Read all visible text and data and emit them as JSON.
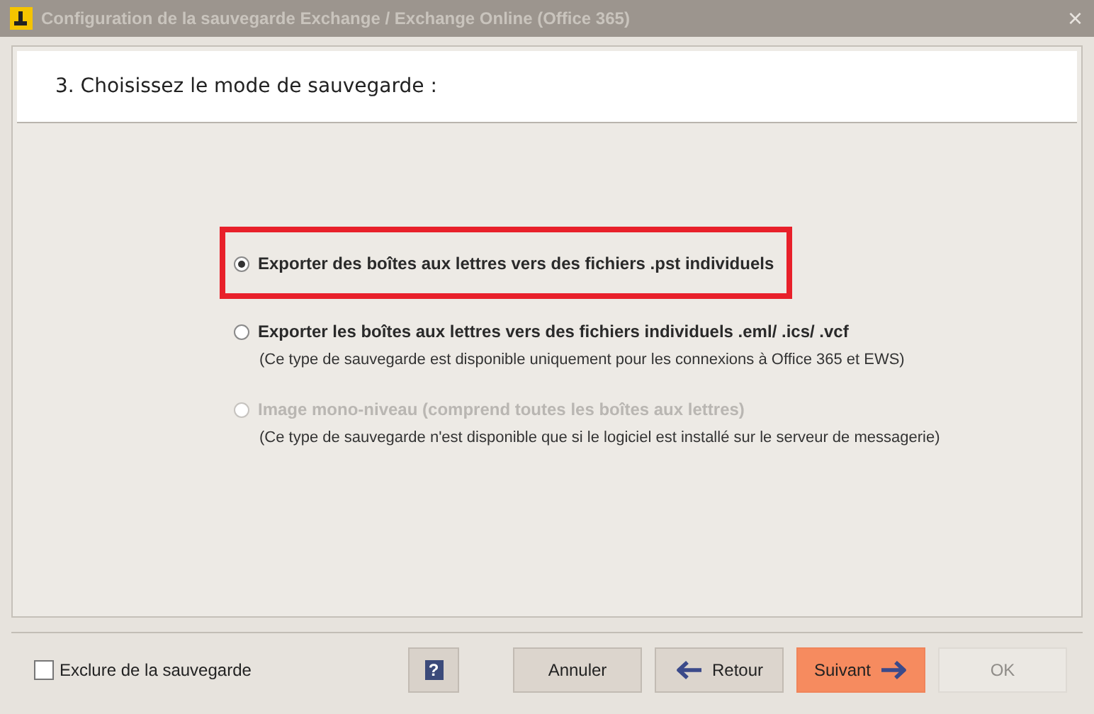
{
  "window": {
    "title": "Configuration de la sauvegarde Exchange / Exchange Online (Office 365)",
    "close": "×"
  },
  "header": {
    "title": "3. Choisissez le mode de sauvegarde :"
  },
  "options": [
    {
      "label": "Exporter des boîtes aux lettres vers des fichiers .pst individuels",
      "selected": true,
      "disabled": false,
      "highlighted": true
    },
    {
      "label": "Exporter les boîtes aux lettres vers des fichiers individuels .eml/ .ics/ .vcf",
      "note": "(Ce type de sauvegarde est disponible uniquement pour les connexions à Office 365 et EWS)",
      "selected": false,
      "disabled": false,
      "highlighted": false
    },
    {
      "label": "Image mono-niveau (comprend toutes les boîtes aux lettres)",
      "note": "(Ce type de sauvegarde n'est disponible que si le logiciel est installé sur le serveur de messagerie)",
      "selected": false,
      "disabled": true,
      "highlighted": false
    }
  ],
  "footer": {
    "exclude": {
      "label": "Exclure de la sauvegarde",
      "checked": false
    },
    "help": "?",
    "buttons": [
      {
        "label": "Annuler",
        "kind": "plain",
        "disabled": false
      },
      {
        "label": "Retour",
        "kind": "back",
        "disabled": false
      },
      {
        "label": "Suivant",
        "kind": "next",
        "disabled": false
      },
      {
        "label": "OK",
        "kind": "plain",
        "disabled": true
      }
    ]
  }
}
